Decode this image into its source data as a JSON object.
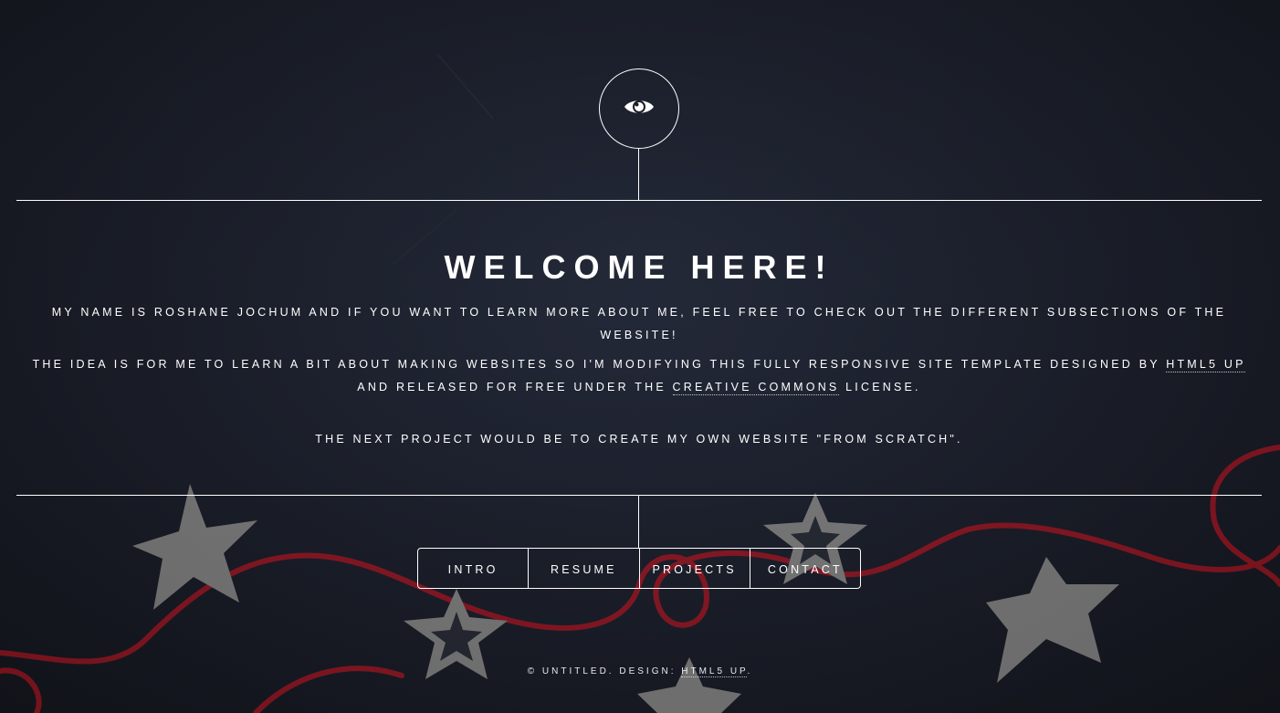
{
  "header": {
    "logo_icon": "eye-icon"
  },
  "main": {
    "title": "WELCOME HERE!",
    "intro_text": "MY NAME IS ROSHANE JOCHUM AND IF YOU WANT TO LEARN MORE ABOUT ME, FEEL FREE TO CHECK OUT THE DIFFERENT SUBSECTIONS OF THE WEBSITE!",
    "idea_text_1": "THE IDEA IS FOR ME TO LEARN A BIT ABOUT MAKING WEBSITES SO I'M MODIFYING THIS FULLY RESPONSIVE SITE TEMPLATE DESIGNED BY ",
    "idea_link_html5up": "HTML5 UP",
    "idea_text_2": " AND RELEASED FOR FREE UNDER THE ",
    "idea_link_cc": "CREATIVE COMMONS",
    "idea_text_3": " LICENSE.",
    "next_project_text": "THE NEXT PROJECT WOULD BE TO CREATE MY OWN WEBSITE \"FROM SCRATCH\"."
  },
  "nav": {
    "items": [
      {
        "label": "INTRO"
      },
      {
        "label": "RESUME"
      },
      {
        "label": "PROJECTS"
      },
      {
        "label": "CONTACT"
      }
    ]
  },
  "footer": {
    "copyright": "© UNTITLED. DESIGN: ",
    "design_link": "HTML5 UP",
    "end": "."
  },
  "colors": {
    "background": "#1b1e27",
    "text": "#ffffff",
    "twine": "#b51622",
    "star": "#9a9895"
  }
}
